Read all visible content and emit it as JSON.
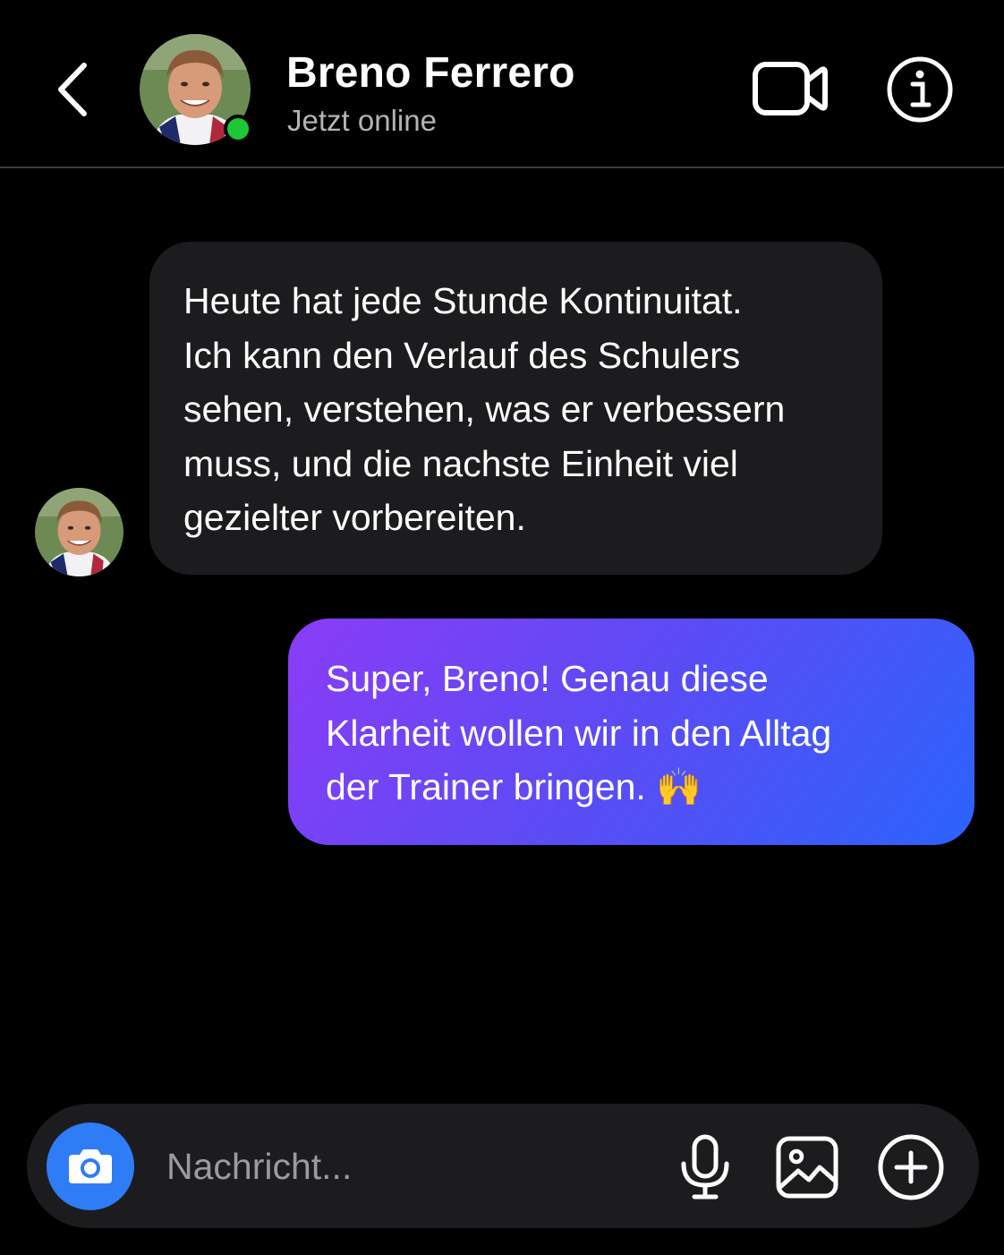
{
  "contact": {
    "name": "Breno Ferrero",
    "status": "Jetzt online"
  },
  "header": {
    "back_icon": "chevron-left-icon",
    "video_icon": "video-camera-icon",
    "info_icon": "info-icon"
  },
  "messages": [
    {
      "direction": "incoming",
      "text": "Heute hat jede Stunde Kontinuitat.\nIch kann den Verlauf des Schulers\nsehen, verstehen, was er verbessern\nmuss, und die nachste Einheit viel\ngezielter vorbereiten."
    },
    {
      "direction": "outgoing",
      "text": "Super, Breno! Genau diese\nKlarheit wollen wir in den Alltag\nder Trainer bringen. 🙌"
    }
  ],
  "composer": {
    "placeholder": "Nachricht...",
    "icons": [
      "camera-icon",
      "microphone-icon",
      "image-icon",
      "plus-icon"
    ]
  },
  "colors": {
    "background": "#000000",
    "incoming_bubble": "#1c1c1e",
    "outgoing_gradient_start": "#8a3cf6",
    "outgoing_gradient_end": "#2b63fb",
    "online_indicator": "#1ec735",
    "camera_button": "#2e7cf6"
  }
}
